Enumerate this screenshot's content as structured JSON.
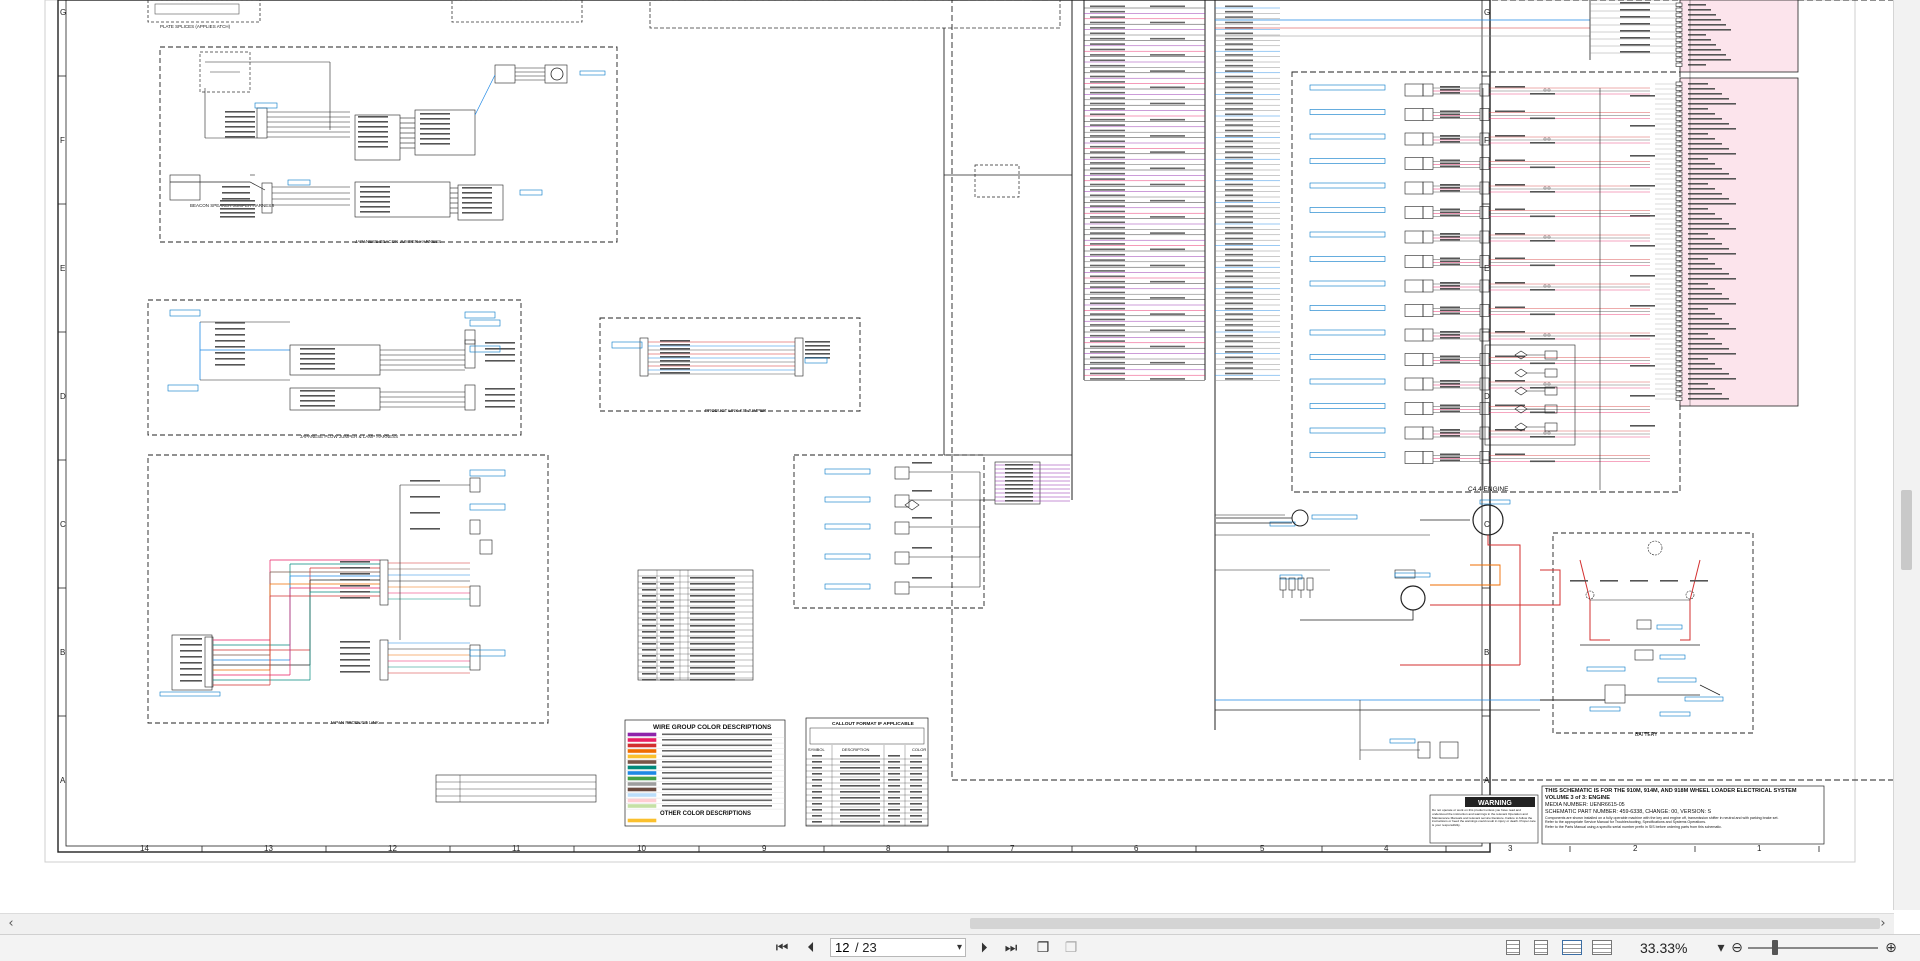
{
  "schematic": {
    "row_letters": [
      "G",
      "F",
      "E",
      "D",
      "C",
      "B",
      "A"
    ],
    "column_numbers": [
      "14",
      "13",
      "12",
      "11",
      "10",
      "9",
      "8",
      "7",
      "6",
      "5",
      "4",
      "3",
      "2",
      "1"
    ],
    "blocks": {
      "beacon_harness": "JAPANESE BEACON JUMPER HARNESS",
      "plow_harness": "JAPANESE PLOW JUMPER & LAMP HARNESS",
      "product_link_jumper": "PRODUCT LINK KIT JUMPER",
      "japan_product_link": "JAPAN PRODUCT LINK",
      "engine_label": "C4.4 ENGINE",
      "battery_label": "BATTERY",
      "top_left_caption": "PLATE SPLICES (APPLIES ATCH)",
      "beacon_speaker": "BEACON SPEAKER JUMPER HARNESS"
    },
    "wire_group_table": {
      "title": "WIRE GROUP COLOR DESCRIPTIONS",
      "other_title": "OTHER COLOR DESCRIPTIONS"
    },
    "callout_table": {
      "title": "CALLOUT FORMAT IF APPLICABLE",
      "symbol_header": "SYMBOL",
      "description_header": "DESCRIPTION",
      "color_header": "COLOR"
    },
    "warning": {
      "heading": "WARNING",
      "body": "Do not operate or work on this product unless you have read and understood the instruction and warnings in the relevant Operation and Maintenance Manuals and relevant service literature. Failure to follow the instructions or heed the warnings could result in injury or death. Proper care is your responsibility."
    },
    "title_block": {
      "line1": "THIS SCHEMATIC IS FOR THE 910M, 914M, AND 918M WHEEL LOADER ELECTRICAL SYSTEM",
      "line2": "VOLUME 3 of 3: ENGINE",
      "line3": "MEDIA NUMBER: UENR6615-05",
      "line4": "SCHEMATIC PART NUMBER: 459-6338, CHANGE: 00, VERSION: S",
      "line5": "Components are shown installed on a fully operable machine with the key and engine off, transmission shifter in neutral and with parking brake set.",
      "line6": "Refer to the appropriate Service Manual for Troubleshooting, Specifications and Systems Operations.",
      "line7": "Refer to the Parts Manual using a specific serial number prefix in SIS before ordering parts from this schematic."
    },
    "colors": {
      "wire_black": "#222222",
      "wire_blue": "#1e88e5",
      "wire_red": "#d32f2f",
      "wire_orange": "#ef6c00",
      "wire_purple": "#8e24aa",
      "wire_pink": "#e91e63",
      "wire_teal": "#00897b",
      "wire_brown": "#795548",
      "wire_yellow": "#fbc02d",
      "link_blue": "#0077c8",
      "pink_panel": "#fce4ec"
    }
  },
  "navigation": {
    "page_current": "12",
    "page_separator": "/ 23",
    "zoom_value": "33.33%",
    "zoom_out_symbol": "⊖",
    "zoom_in_symbol": "⊕"
  }
}
